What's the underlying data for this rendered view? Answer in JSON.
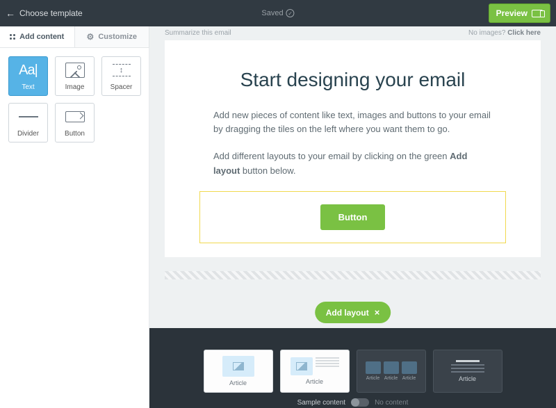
{
  "topbar": {
    "back_label": "Choose template",
    "saved_label": "Saved",
    "preview_label": "Preview"
  },
  "tabs": {
    "add_content": "Add content",
    "customize": "Customize"
  },
  "tiles": {
    "text": "Text",
    "image": "Image",
    "spacer": "Spacer",
    "divider": "Divider",
    "button": "Button"
  },
  "editor_head": {
    "summary": "Summarize this email",
    "no_images": "No images?",
    "click_here": "Click here"
  },
  "email": {
    "title": "Start designing your email",
    "p1": "Add new pieces of content like text, images and buttons to your email by dragging the tiles on the left where you want them to go.",
    "p2_a": "Add different layouts to your email by clicking on the green ",
    "p2_bold": "Add layout",
    "p2_b": " button below.",
    "button_label": "Button"
  },
  "add_layout": "Add layout",
  "layouts": {
    "article": "Article"
  },
  "toggle": {
    "sample": "Sample content",
    "none": "No content"
  }
}
